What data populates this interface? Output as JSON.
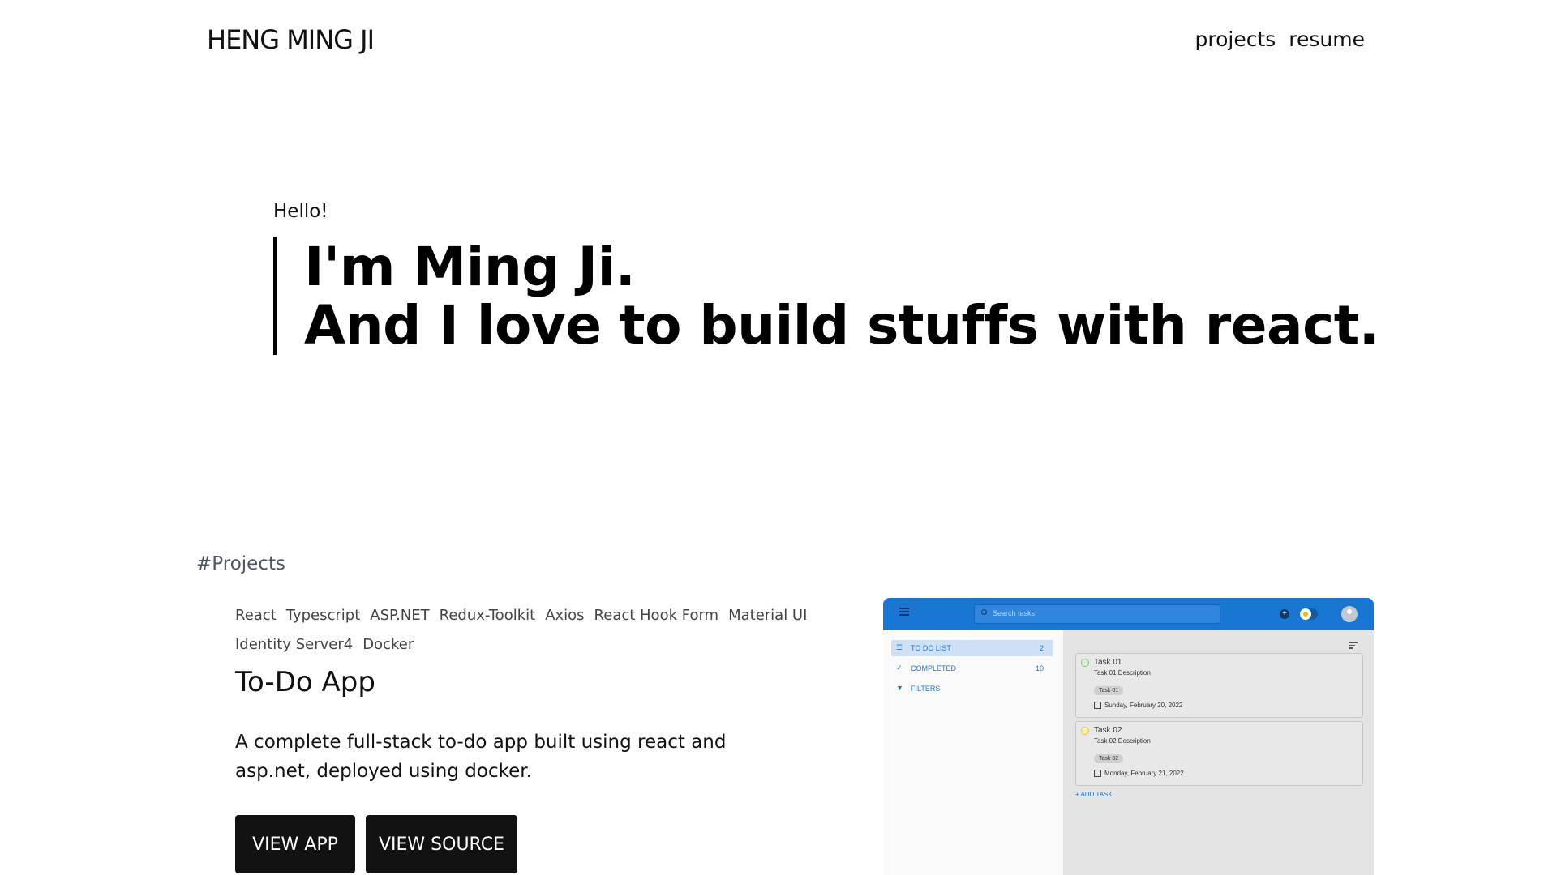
{
  "header": {
    "brand": "HENG MING JI",
    "nav": [
      "projects",
      "resume"
    ]
  },
  "hero": {
    "greeting": "Hello!",
    "line1": "I'm Ming Ji.",
    "line2": "And I love to build stuffs with react."
  },
  "projects": {
    "section_title": "#Projects",
    "items": [
      {
        "tags": [
          "React",
          "Typescript",
          "ASP.NET",
          "Redux-Toolkit",
          "Axios",
          "React Hook Form",
          "Material UI",
          "Identity Server4",
          "Docker"
        ],
        "title": "To-Do App",
        "description": "A complete full-stack to-do app built using react and asp.net, deployed using docker.",
        "view_app_label": "VIEW APP",
        "view_source_label": "VIEW SOURCE"
      }
    ]
  },
  "preview": {
    "search_placeholder": "Search tasks",
    "sidebar": [
      {
        "label": "TO DO LIST",
        "count": "2",
        "icon": "list-icon"
      },
      {
        "label": "COMPLETED",
        "count": "10",
        "icon": "check-icon"
      },
      {
        "label": "FILTERS",
        "count": "",
        "icon": "filter-icon"
      }
    ],
    "tasks": [
      {
        "title": "Task 01",
        "description": "Task 01 Description",
        "tag": "Task 01",
        "date": "Sunday, February 20, 2022",
        "status_color": "#7cc77c"
      },
      {
        "title": "Task 02",
        "description": "Task 02 Description",
        "tag": "Task 02",
        "date": "Monday, February 21, 2022",
        "status_color": "#f2c230"
      }
    ],
    "add_task_label": "ADD TASK",
    "accent_color": "#1976d2"
  }
}
